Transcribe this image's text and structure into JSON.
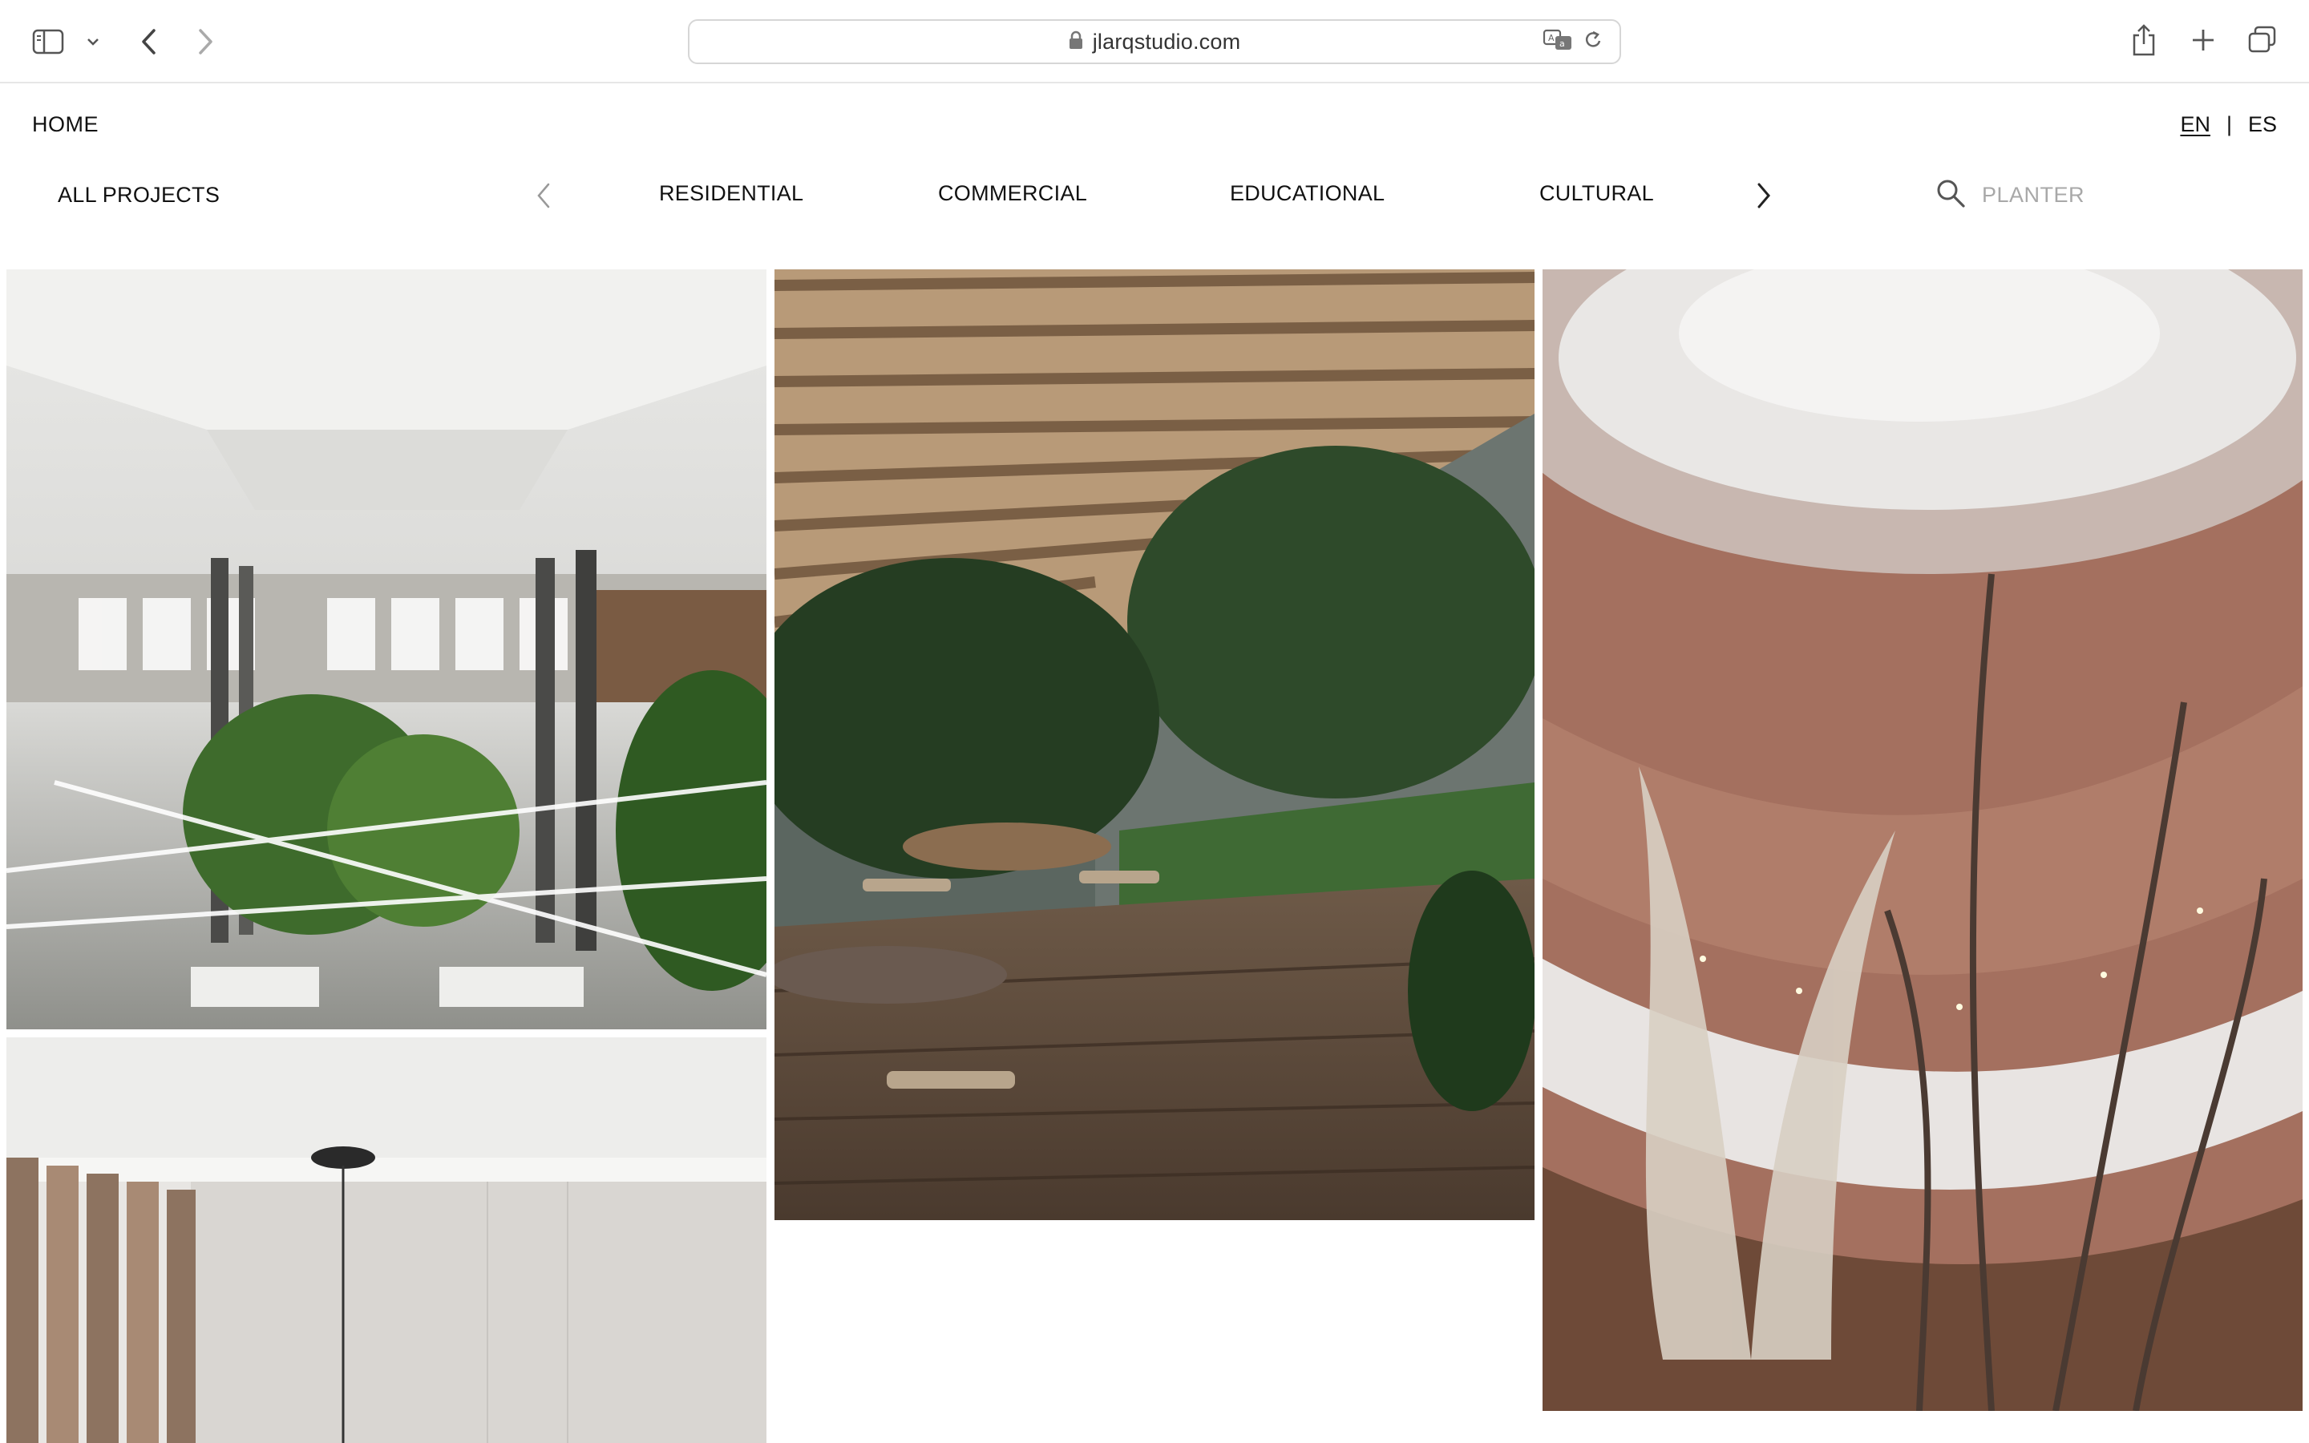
{
  "browser": {
    "url": "jlarqstudio.com",
    "icons": [
      "sidebar-icon",
      "chevron-down-icon",
      "back-icon",
      "forward-icon",
      "lock-icon",
      "translate-icon",
      "reload-icon",
      "share-icon",
      "new-tab-icon",
      "tabs-overview-icon"
    ]
  },
  "site": {
    "home_label": "HOME",
    "languages": [
      "EN",
      "ES"
    ],
    "language_separator": "|",
    "active_language": "EN"
  },
  "categories": {
    "all_label": "ALL PROJECTS",
    "items": [
      "RESIDENTIAL",
      "COMMERCIAL",
      "EDUCATIONAL",
      "CULTURAL"
    ]
  },
  "search": {
    "placeholder": "PLANTER"
  },
  "gallery": {
    "tiles": [
      {
        "name": "atrium-office-render"
      },
      {
        "name": "pergola-garden-terrace-render"
      },
      {
        "name": "spiral-atrium-sculpture-render"
      },
      {
        "name": "interior-pendant-curtain-render"
      }
    ]
  },
  "colors": {
    "text": "#111111",
    "placeholder": "#a8a8a8",
    "chrome_border": "#e6e6e6"
  }
}
